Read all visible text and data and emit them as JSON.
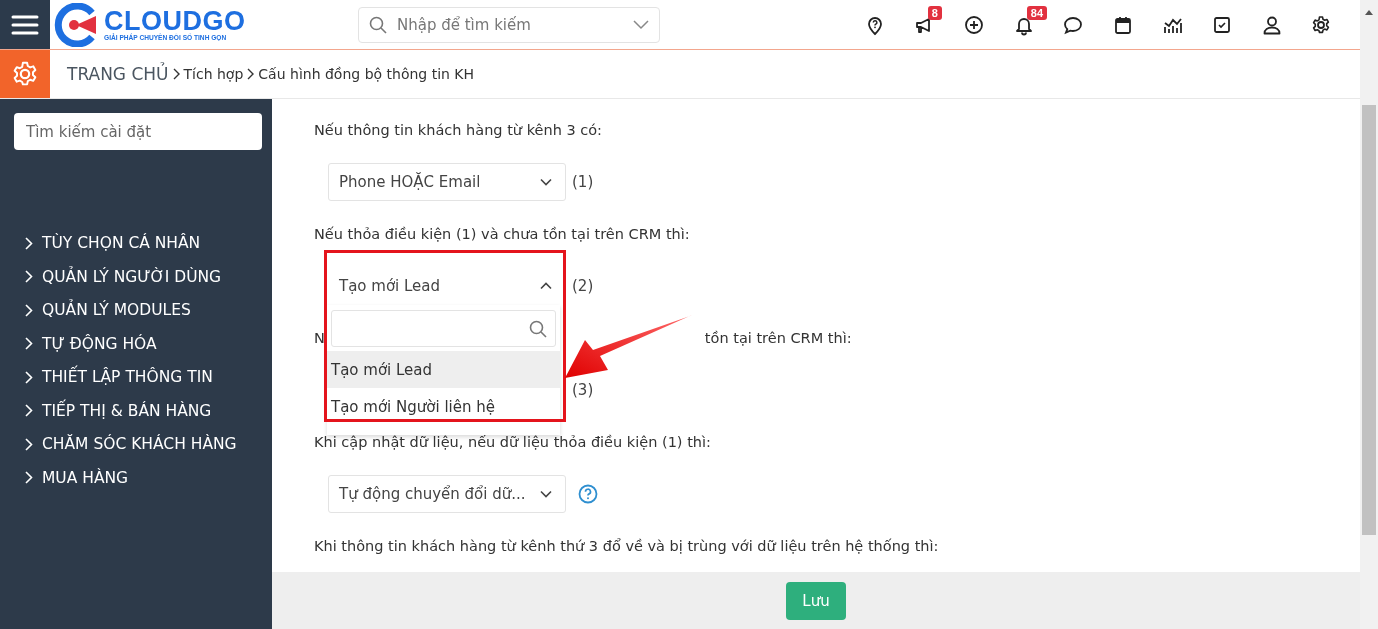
{
  "header": {
    "logo": {
      "name": "CLOUDGO",
      "tagline": "GIẢI PHÁP CHUYỂN ĐỔI SỐ TINH GỌN"
    },
    "search": {
      "placeholder": "Nhập để tìm kiếm"
    },
    "icons": [
      {
        "kind": "pin"
      },
      {
        "kind": "megaphone",
        "badge": "8"
      },
      {
        "kind": "plus"
      },
      {
        "kind": "bell",
        "badge": "84"
      },
      {
        "kind": "chat"
      },
      {
        "kind": "calendar"
      },
      {
        "kind": "chart"
      },
      {
        "kind": "task"
      },
      {
        "kind": "user"
      },
      {
        "kind": "gear"
      }
    ]
  },
  "breadcrumb": [
    "TRANG CHỦ",
    "Tích hợp",
    "Cấu hình đồng bộ thông tin KH"
  ],
  "sidebar": {
    "search": {
      "placeholder": "Tìm kiếm cài đặt"
    },
    "items": [
      "TÙY CHỌN CÁ NHÂN",
      "QUẢN LÝ NGƯỜI DÙNG",
      "QUẢN LÝ MODULES",
      "TỰ ĐỘNG HÓA",
      "THIẾT LẬP THÔNG TIN",
      "TIẾP THỊ & BÁN HÀNG",
      "CHĂM SÓC KHÁCH HÀNG",
      "MUA HÀNG"
    ]
  },
  "form": [
    {
      "label": [
        "Nếu thông tin khách hàng từ kênh 3 có:"
      ],
      "select": {
        "value": "Phone HOẶC Email",
        "open": false,
        "note": "(1)"
      }
    },
    {
      "label": [
        "Nếu thỏa điều kiện (1) và chưa tồn tại trên CRM thì:"
      ],
      "select": {
        "value": "Tạo mới Lead",
        "open": true,
        "note": "(2)",
        "options": [
          {
            "label": "Tạo mới Lead",
            "selected": true
          },
          {
            "label": "Tạo mới Người liên hệ",
            "selected": false
          }
        ]
      }
    },
    {
      "label": [
        "N",
        "tồn tại trên CRM thì:"
      ],
      "select": {
        "note": "(3)"
      }
    },
    {
      "label": [
        "Khi cập nhật dữ liệu, nếu dữ liệu thỏa điều kiện (1) thì:"
      ],
      "select": {
        "value": "Tự động chuyển đổi dữ...",
        "open": false,
        "help": true
      }
    },
    {
      "label": [
        "Khi thông tin khách hàng từ kênh thứ 3 đổ về và bị trùng với dữ liệu trên hệ thống thì:"
      ]
    }
  ],
  "save_button": "Lưu"
}
